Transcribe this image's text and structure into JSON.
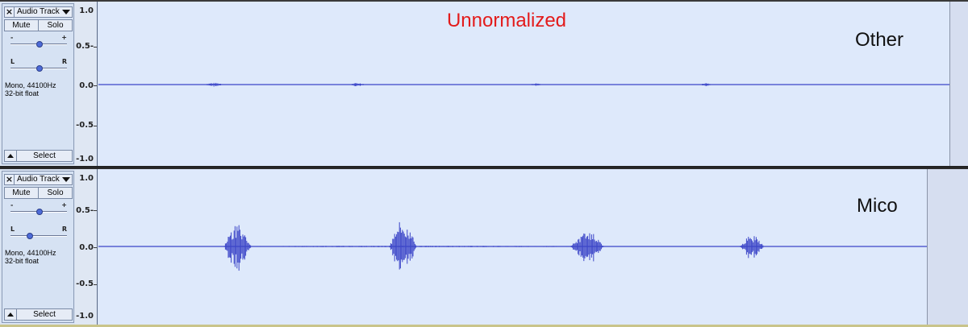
{
  "title": "Unnormalized",
  "tracks": [
    {
      "name": "Audio Track",
      "mute_label": "Mute",
      "solo_label": "Solo",
      "gain_minus": "-",
      "gain_plus": "+",
      "pan_left": "L",
      "pan_right": "R",
      "format_line1": "Mono, 44100Hz",
      "format_line2": "32-bit float",
      "select_label": "Select",
      "label": "Other",
      "ruler_ticks": [
        "1.0",
        "0.5-",
        "0.0",
        "-0.5",
        "-1.0"
      ],
      "wave_color": "#3b45c8"
    },
    {
      "name": "Audio Track",
      "mute_label": "Mute",
      "solo_label": "Solo",
      "gain_minus": "-",
      "gain_plus": "+",
      "pan_left": "L",
      "pan_right": "R",
      "format_line1": "Mono, 44100Hz",
      "format_line2": "32-bit float",
      "select_label": "Select",
      "label": "Mico",
      "ruler_ticks": [
        "1.0",
        "0.5-",
        "0.0",
        "-0.5",
        "-1.0"
      ],
      "wave_color": "#3b45c8"
    }
  ],
  "icons": {
    "close": "close-icon",
    "dropdown": "chevron-down-icon",
    "collapse": "collapse-up-icon"
  }
}
